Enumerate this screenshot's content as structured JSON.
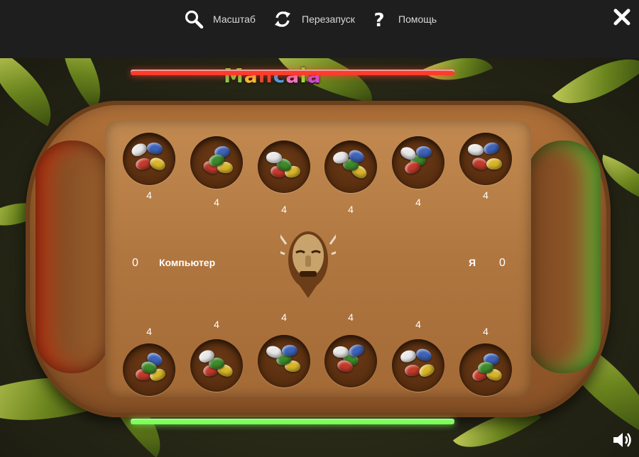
{
  "toolbar": {
    "zoom_label": "Масштаб",
    "restart_label": "Перезапуск",
    "help_label": "Помощь"
  },
  "icons": {
    "zoom": "magnifier-icon",
    "restart": "restart-arrows-icon",
    "help": "question-mark-icon",
    "close": "close-icon",
    "sound": "speaker-icon"
  },
  "game": {
    "logo": [
      "M",
      "a",
      "n",
      "c",
      "a",
      "l",
      "a"
    ],
    "logo_colors": [
      "#7fd34a",
      "#f2c13a",
      "#e4472f",
      "#3fa7e8",
      "#ef7ad1",
      "#9be23a",
      "#d14ae8"
    ],
    "computer": {
      "name": "Компьютер",
      "store": "0",
      "side_color": "#ff3b2b"
    },
    "player": {
      "name": "Я",
      "store": "0",
      "side_color": "#7dff5a"
    },
    "top_pits": [
      "4",
      "4",
      "4",
      "4",
      "4",
      "4"
    ],
    "bottom_pits": [
      "4",
      "4",
      "4",
      "4",
      "4",
      "4"
    ]
  }
}
